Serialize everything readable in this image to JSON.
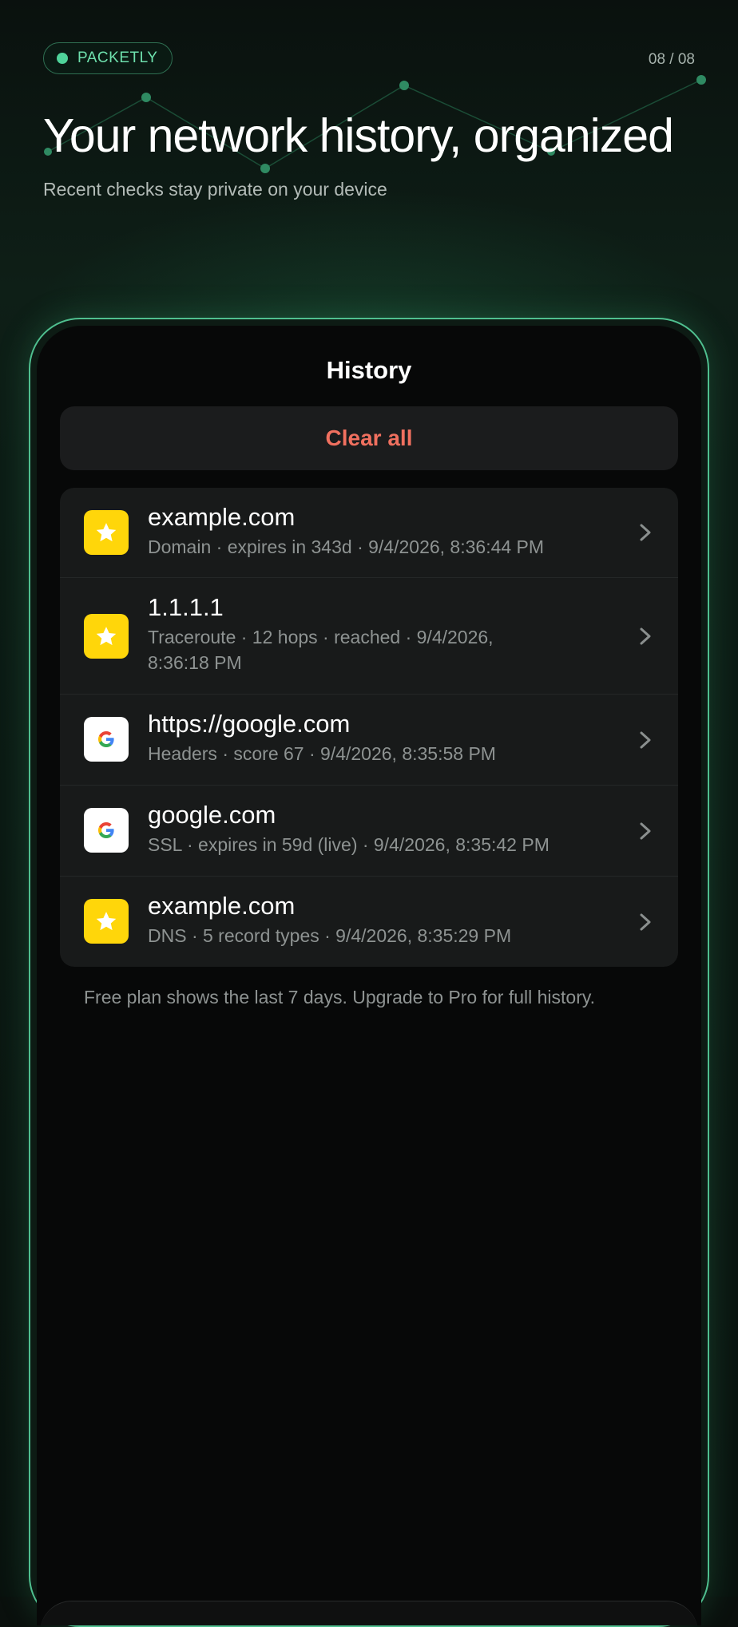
{
  "header": {
    "brand": "PACKETLY",
    "page_indicator": "08 / 08",
    "headline": "Your network history, organized",
    "subhead": "Recent checks stay private on your device"
  },
  "screen": {
    "title": "History",
    "clear_label": "Clear all",
    "items": [
      {
        "title": "example.com",
        "subtitle": "Domain · expires in 343d · 9/4/2026, 8:36:44 PM",
        "icon": "star-icon"
      },
      {
        "title": "1.1.1.1",
        "subtitle": "Traceroute · 12 hops · reached · 9/4/2026, 8:36:18 PM",
        "icon": "star-icon"
      },
      {
        "title": "https://google.com",
        "subtitle": "Headers · score 67 · 9/4/2026, 8:35:58 PM",
        "icon": "google-icon"
      },
      {
        "title": "google.com",
        "subtitle": "SSL · expires in 59d (live) · 9/4/2026, 8:35:42 PM",
        "icon": "google-icon"
      },
      {
        "title": "example.com",
        "subtitle": "DNS · 5 record types · 9/4/2026, 8:35:29 PM",
        "icon": "star-icon"
      }
    ],
    "footnote": "Free plan shows the last 7 days. Upgrade to Pro for full history."
  },
  "colors": {
    "accent": "#4fd39a",
    "destructive": "#f0705f",
    "star_badge": "#ffd60a"
  }
}
